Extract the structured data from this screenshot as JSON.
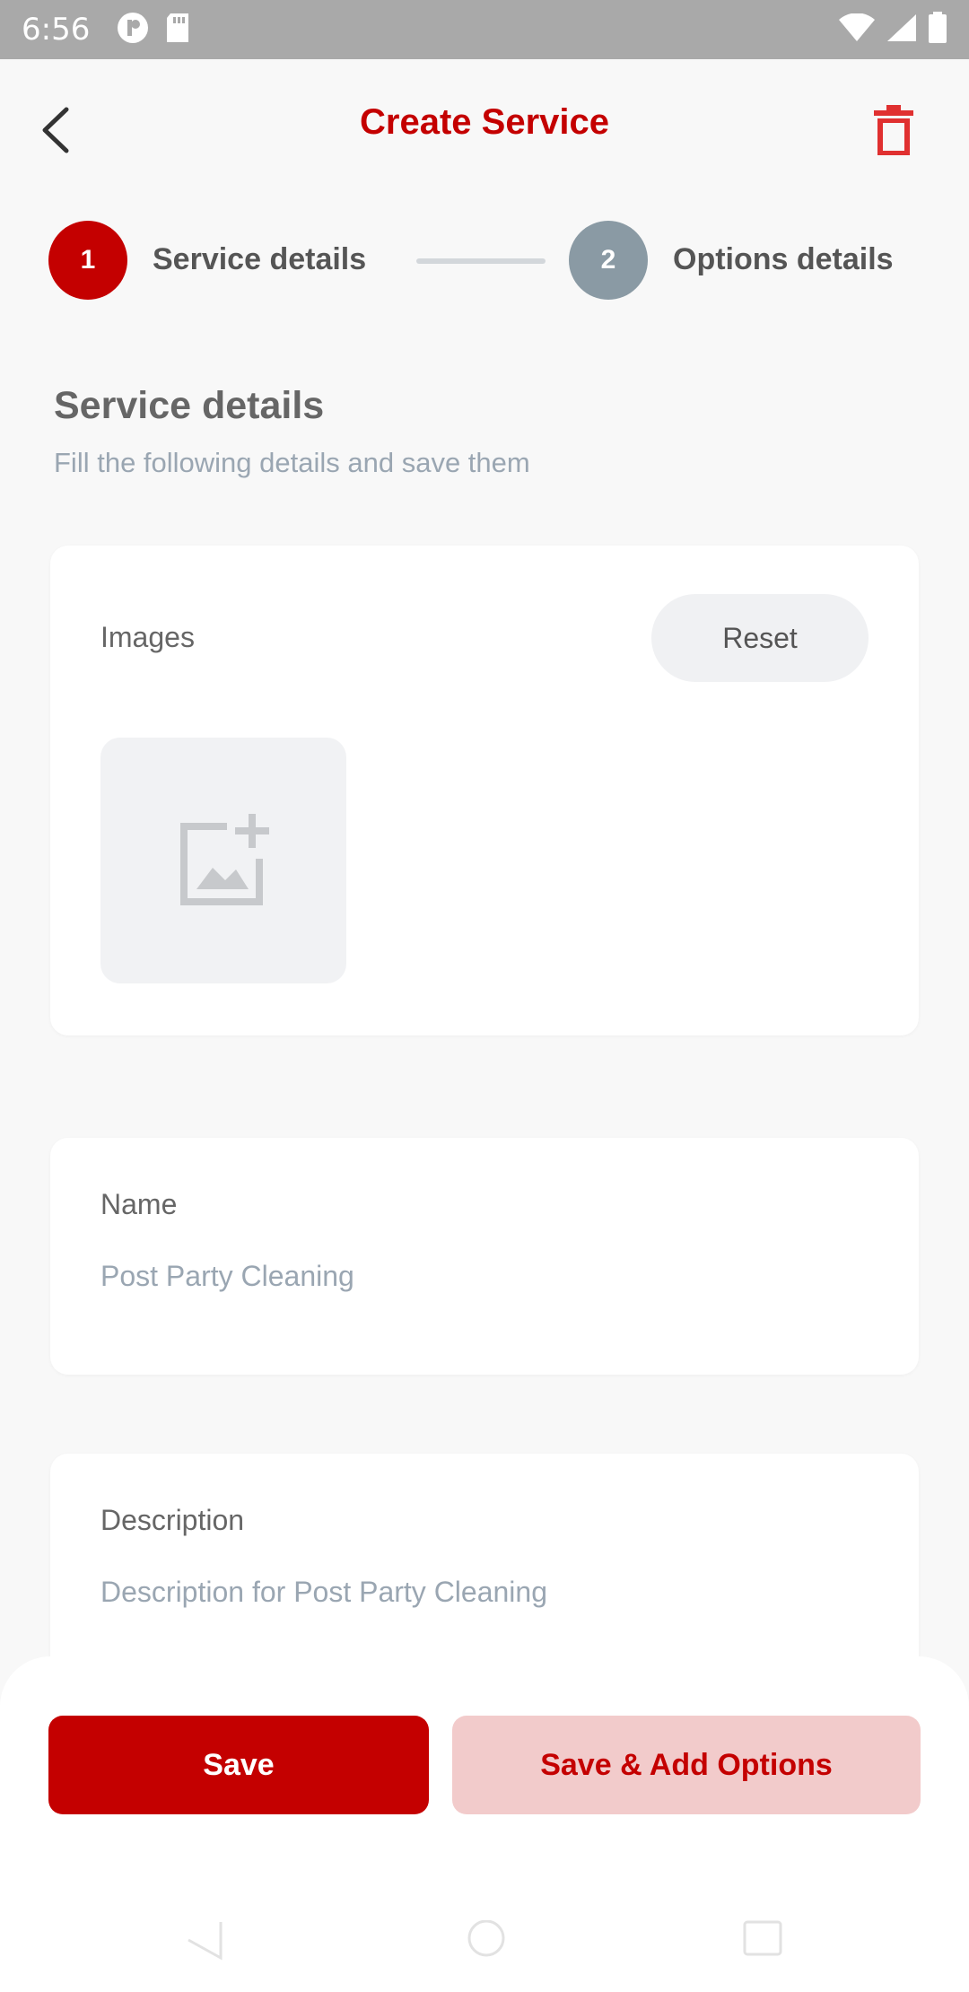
{
  "status_bar": {
    "time": "6:56",
    "icons": [
      "app-icon",
      "sd-card-icon",
      "wifi-icon",
      "signal-icon",
      "battery-icon"
    ]
  },
  "app_bar": {
    "title": "Create Service",
    "back_icon": "chevron-left-icon",
    "delete_icon": "trash-icon"
  },
  "stepper": {
    "steps": [
      {
        "number": "1",
        "label": "Service details",
        "active": true
      },
      {
        "number": "2",
        "label": "Options details",
        "active": false
      }
    ]
  },
  "section": {
    "title": "Service details",
    "subtitle": "Fill the following details and save them"
  },
  "images_card": {
    "label": "Images",
    "reset_label": "Reset",
    "add_image_icon": "add-photo-icon"
  },
  "name_field": {
    "label": "Name",
    "value": "Post Party Cleaning"
  },
  "description_field": {
    "label": "Description",
    "value": "Description for Post Party Cleaning"
  },
  "actions": {
    "save_label": "Save",
    "save_add_label": "Save & Add Options"
  },
  "colors": {
    "primary": "#c40000",
    "primary_light": "#f2cbcb",
    "inactive_step": "#8a9aa4",
    "muted_text": "#9aa6b2"
  }
}
